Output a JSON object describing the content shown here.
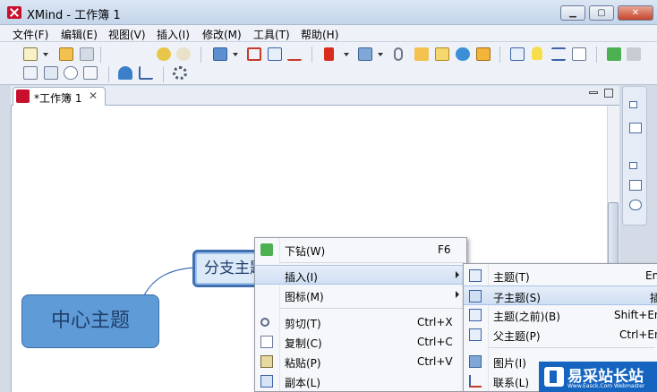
{
  "window": {
    "title": "XMind - 工作簿 1",
    "minimize_glyph": "▁",
    "maximize_glyph": "▢",
    "close_glyph": "✕"
  },
  "menubar": [
    "文件(F)",
    "编辑(E)",
    "视图(V)",
    "插入(I)",
    "修改(M)",
    "工具(T)",
    "帮助(H)"
  ],
  "toolbar": {
    "row1_icons": [
      "new-workbook-icon",
      "open-icon",
      "save-icon",
      "undo-icon",
      "redo-icon",
      "insert-topic-icon",
      "boundary-icon",
      "summary-icon",
      "relationship-icon",
      "marker-flag-icon",
      "image-icon",
      "attachment-icon",
      "label-icon",
      "notes-icon",
      "hyperlink-icon",
      "audio-icon",
      "presentation-icon",
      "idea-icon",
      "gantt-icon",
      "task-icon",
      "drill-down-icon",
      "drill-up-icon"
    ],
    "row2_icons": [
      "outline-icon",
      "overview-icon",
      "clock-icon",
      "search-icon",
      "upload-icon",
      "share-icon",
      "settings-icon"
    ]
  },
  "editor": {
    "tab_title": "*工作簿 1",
    "tab_close": "✕"
  },
  "mindmap": {
    "central_topic": "中心主题",
    "branch_topic": "分支主题"
  },
  "context_menu": {
    "items": [
      {
        "label": "下钻(W)",
        "shortcut": "F6",
        "icon": "drill-down-icon"
      },
      {
        "label": "插入(I)",
        "shortcut": "",
        "icon": "",
        "submenu": true
      },
      {
        "label": "图标(M)",
        "shortcut": "",
        "icon": "",
        "submenu": true
      },
      {
        "label": "剪切(T)",
        "shortcut": "Ctrl+X",
        "icon": "scissors-icon"
      },
      {
        "label": "复制(C)",
        "shortcut": "Ctrl+C",
        "icon": "copy-icon"
      },
      {
        "label": "粘贴(P)",
        "shortcut": "Ctrl+V",
        "icon": "paste-icon"
      },
      {
        "label": "副本(L)",
        "shortcut": "",
        "icon": "duplicate-icon"
      }
    ]
  },
  "submenu": {
    "items": [
      {
        "label": "主题(T)",
        "shortcut": "En",
        "icon": "topic-icon"
      },
      {
        "label": "子主题(S)",
        "shortcut": "插",
        "icon": "subtopic-icon"
      },
      {
        "label": "主题(之前)(B)",
        "shortcut": "Shift+En",
        "icon": "topic-before-icon"
      },
      {
        "label": "父主题(P)",
        "shortcut": "Ctrl+En",
        "icon": "parent-topic-icon"
      },
      {
        "label": "图片(I)",
        "shortcut": "",
        "icon": "picture-icon"
      },
      {
        "label": "联系(L)",
        "shortcut": "",
        "icon": "relationship-icon"
      }
    ]
  },
  "watermark": {
    "text": "易采站长站",
    "subtext": "Www.Easck.Com Webmaster"
  },
  "colors": {
    "central_topic": "#5f9bd6",
    "branch_border": "#3f6fb0",
    "menu_highlight": "#cfdff3",
    "brand_red": "#c8102e"
  }
}
